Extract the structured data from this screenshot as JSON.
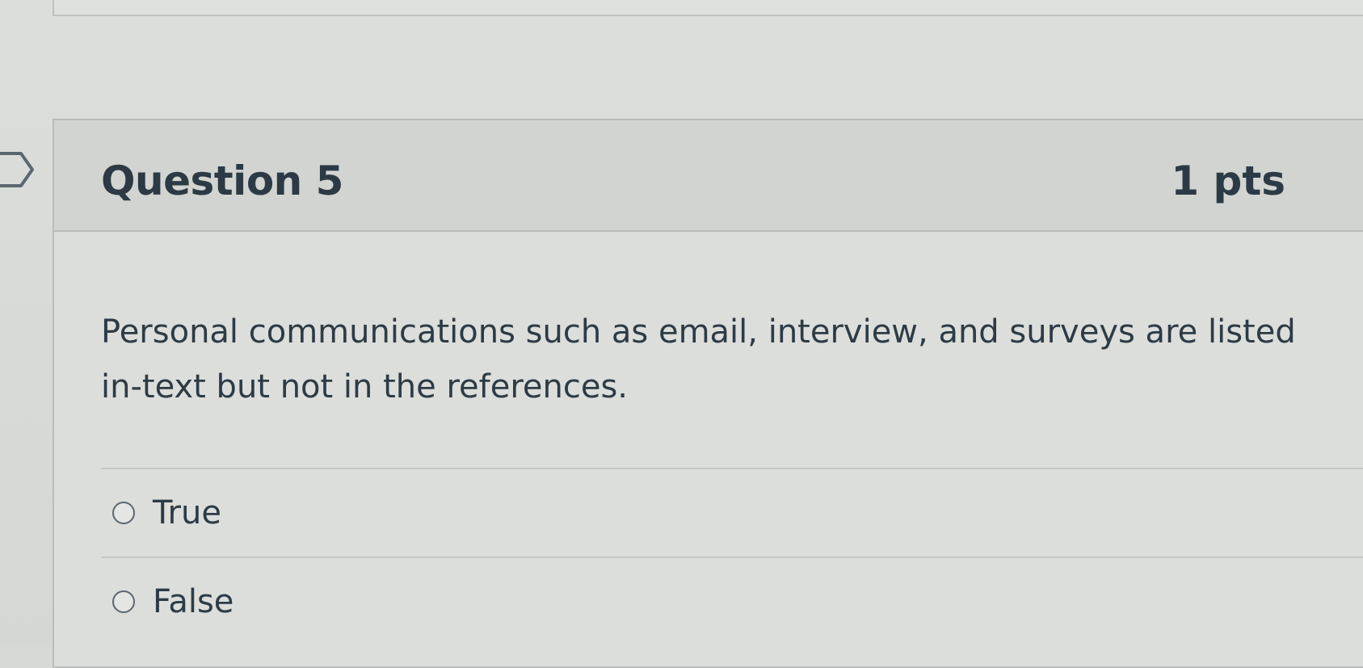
{
  "question": {
    "title": "Question 5",
    "points": "1 pts",
    "text": "Personal communications such as email, interview, and surveys are listed in-text but not in the references."
  },
  "answers": [
    {
      "label": "True",
      "selected": false
    },
    {
      "label": "False",
      "selected": false
    }
  ],
  "icons": {
    "flag": "flag-question-icon",
    "radio": "radio-unselected-icon"
  }
}
